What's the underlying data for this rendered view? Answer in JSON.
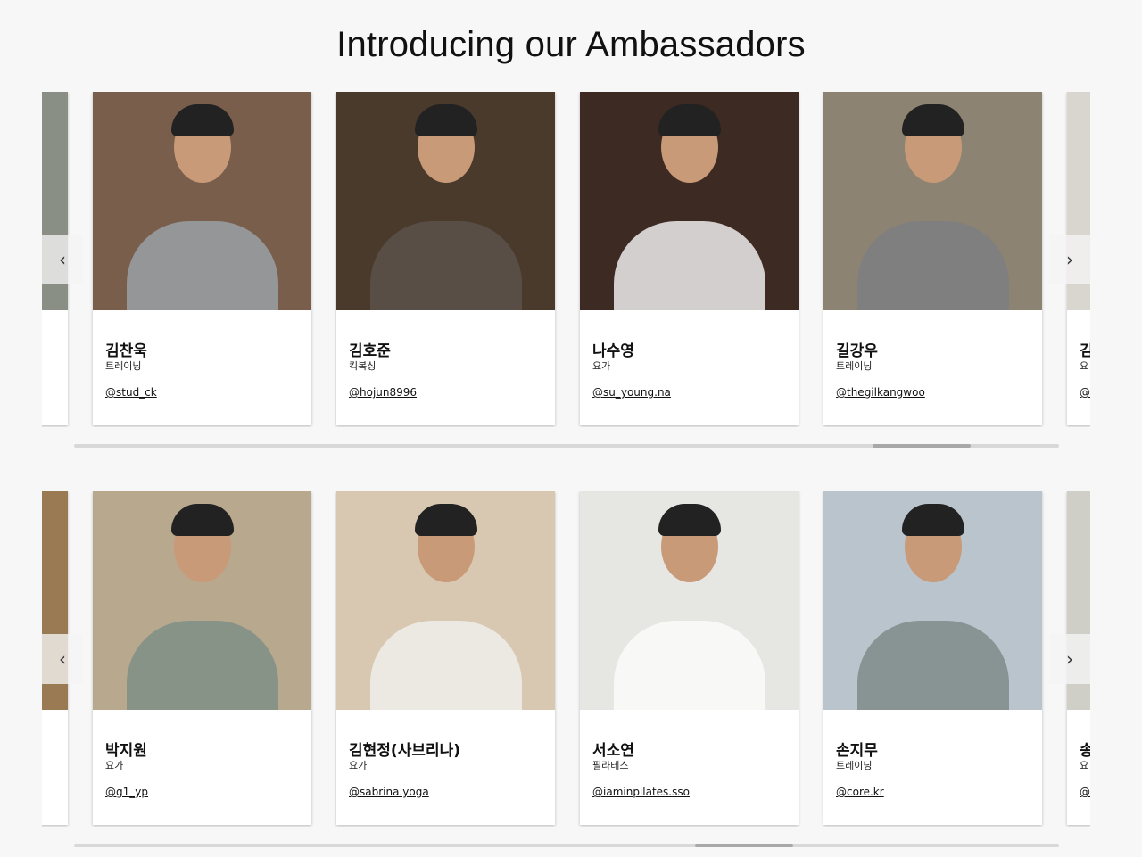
{
  "title": "Introducing our Ambassadors",
  "carousel1": {
    "cards": [
      {
        "name": "",
        "category": "",
        "handle": "",
        "bg": "#8a8f86"
      },
      {
        "name": "김찬욱",
        "category": "트레이닝",
        "handle": "@stud_ck",
        "bg": "#7a5e4c"
      },
      {
        "name": "김호준",
        "category": "킥복싱",
        "handle": "@hojun8996",
        "bg": "#4a3a2c"
      },
      {
        "name": "나수영",
        "category": "요가",
        "handle": "@su_young.na",
        "bg": "#3d2a22"
      },
      {
        "name": "길강우",
        "category": "트레이닝",
        "handle": "@thegilkangwoo",
        "bg": "#8c8372"
      },
      {
        "name": "김",
        "category": "요",
        "handle": "@",
        "bg": "#d9d6d0"
      }
    ],
    "scroll_position": 0.9
  },
  "carousel2": {
    "cards": [
      {
        "name": "",
        "category": "",
        "handle": "",
        "bg": "#9a7a52"
      },
      {
        "name": "박지원",
        "category": "요가",
        "handle": "@g1_yp",
        "bg": "#b8a88e"
      },
      {
        "name": "김현정(사브리나)",
        "category": "요가",
        "handle": "@sabrina.yoga",
        "bg": "#d8c8b2"
      },
      {
        "name": "서소연",
        "category": "필라테스",
        "handle": "@iaminpilates.sso",
        "bg": "#e6e6e2"
      },
      {
        "name": "손지무",
        "category": "트레이닝",
        "handle": "@core.kr",
        "bg": "#b9c4cc"
      },
      {
        "name": "송",
        "category": "요",
        "handle": "@",
        "bg": "#cfcfc8"
      }
    ],
    "scroll_position": 0.7
  },
  "arrows": {
    "prev": "‹",
    "next": "›"
  }
}
